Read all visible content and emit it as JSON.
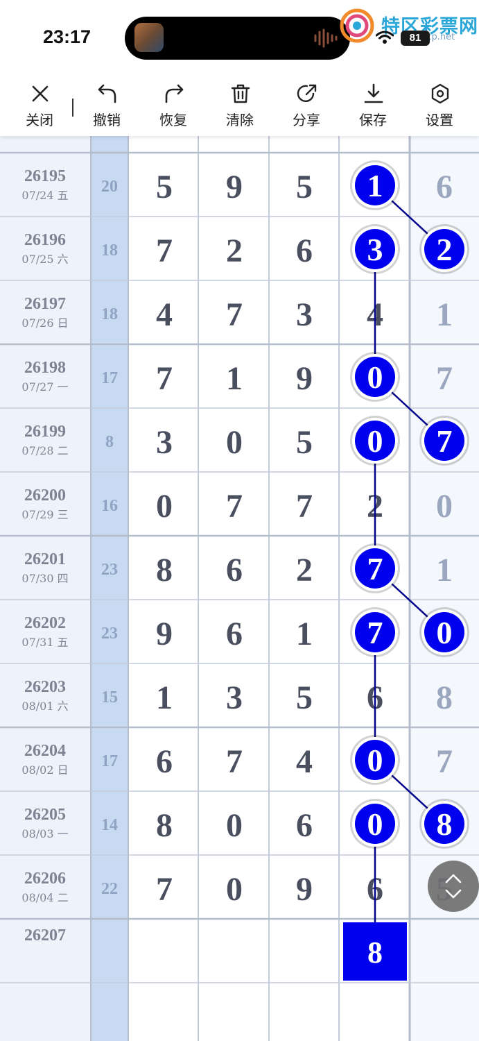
{
  "status": {
    "time": "23:17",
    "battery": "81",
    "watermark_text": "特区彩票网",
    "watermark_url": "tqcp.net"
  },
  "toolbar": {
    "items": [
      {
        "label": "关闭",
        "icon": "close-icon"
      },
      {
        "label": "撤销",
        "icon": "undo-icon"
      },
      {
        "label": "恢复",
        "icon": "redo-icon"
      },
      {
        "label": "清除",
        "icon": "trash-icon"
      },
      {
        "label": "分享",
        "icon": "share-icon"
      },
      {
        "label": "保存",
        "icon": "download-icon"
      },
      {
        "label": "设置",
        "icon": "gear-icon"
      }
    ]
  },
  "rows": [
    {
      "issue": "26195",
      "date": "07/24 五",
      "sum": "20",
      "digits": [
        "5",
        "9",
        "5",
        "1",
        "6"
      ]
    },
    {
      "issue": "26196",
      "date": "07/25 六",
      "sum": "18",
      "digits": [
        "7",
        "2",
        "6",
        "3",
        "2"
      ]
    },
    {
      "issue": "26197",
      "date": "07/26 日",
      "sum": "18",
      "digits": [
        "4",
        "7",
        "3",
        "4",
        "1"
      ]
    },
    {
      "issue": "26198",
      "date": "07/27 一",
      "sum": "17",
      "digits": [
        "7",
        "1",
        "9",
        "0",
        "7"
      ]
    },
    {
      "issue": "26199",
      "date": "07/28 二",
      "sum": "8",
      "digits": [
        "3",
        "0",
        "5",
        "0",
        "7"
      ]
    },
    {
      "issue": "26200",
      "date": "07/29 三",
      "sum": "16",
      "digits": [
        "0",
        "7",
        "7",
        "2",
        "0"
      ]
    },
    {
      "issue": "26201",
      "date": "07/30 四",
      "sum": "23",
      "digits": [
        "8",
        "6",
        "2",
        "7",
        "1"
      ]
    },
    {
      "issue": "26202",
      "date": "07/31 五",
      "sum": "23",
      "digits": [
        "9",
        "6",
        "1",
        "7",
        "0"
      ]
    },
    {
      "issue": "26203",
      "date": "08/01 六",
      "sum": "15",
      "digits": [
        "1",
        "3",
        "5",
        "6",
        "8"
      ]
    },
    {
      "issue": "26204",
      "date": "08/02 日",
      "sum": "17",
      "digits": [
        "6",
        "7",
        "4",
        "0",
        "7"
      ]
    },
    {
      "issue": "26205",
      "date": "08/03 一",
      "sum": "14",
      "digits": [
        "8",
        "0",
        "6",
        "0",
        "8"
      ]
    },
    {
      "issue": "26206",
      "date": "08/04 二",
      "sum": "22",
      "digits": [
        "7",
        "0",
        "9",
        "6",
        "5"
      ]
    },
    {
      "issue": "26207",
      "date": "",
      "sum": "",
      "digits": [
        "",
        "",
        "",
        "8",
        ""
      ]
    }
  ],
  "marks": [
    {
      "row": 0,
      "col": 3
    },
    {
      "row": 1,
      "col": 4
    },
    {
      "row": 1,
      "col": 3
    },
    {
      "row": 3,
      "col": 3
    },
    {
      "row": 4,
      "col": 4
    },
    {
      "row": 4,
      "col": 3
    },
    {
      "row": 6,
      "col": 3
    },
    {
      "row": 7,
      "col": 4
    },
    {
      "row": 7,
      "col": 3
    },
    {
      "row": 9,
      "col": 3
    },
    {
      "row": 10,
      "col": 4
    },
    {
      "row": 10,
      "col": 3
    }
  ],
  "lines": [
    [
      0,
      3,
      1,
      4
    ],
    [
      1,
      3,
      3,
      3
    ],
    [
      3,
      3,
      4,
      4
    ],
    [
      4,
      3,
      6,
      3
    ],
    [
      6,
      3,
      7,
      4
    ],
    [
      7,
      3,
      9,
      3
    ],
    [
      9,
      3,
      10,
      4
    ],
    [
      10,
      3,
      12,
      3
    ]
  ],
  "prediction": {
    "row": 12,
    "col": 3,
    "value": "8"
  },
  "colors": {
    "mark_fill": "#0000ee",
    "mark_ring": "#ffffff",
    "line": "#00008b",
    "prediction_fill": "#0000ee",
    "digit": "#4a4f60",
    "digit_faded": "#9ba6bf",
    "issue_text": "#7d8494",
    "sum_text": "#8fa3c2",
    "sum_col_bg": "#c8daf2",
    "left_bg": "#eef3fb",
    "grid_line": "#c3cbda",
    "grid_line_strong": "#b4bdcc"
  }
}
